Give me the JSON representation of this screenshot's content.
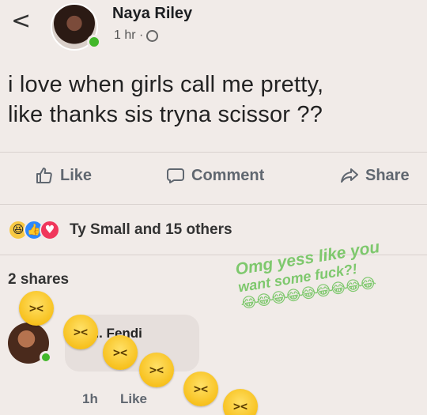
{
  "header": {
    "back_glyph": "<",
    "author": "Naya Riley",
    "time": "1 hr · "
  },
  "post": {
    "text_line1": "i love when girls call me pretty,",
    "text_line2": "like thanks sis tryna scissor ??"
  },
  "actions": {
    "like": "Like",
    "comment": "Comment",
    "share": "Share"
  },
  "reactions": {
    "summary": "Ty Small and 15 others",
    "types": [
      "haha",
      "like",
      "love"
    ]
  },
  "shares": "2 shares",
  "overlay_caption": {
    "line1": "Omg yess like you",
    "line2": "want some fuck?!",
    "emojis": "😂😂😂😂😂😂😂😂😂"
  },
  "comment": {
    "author": "d.. Fendi",
    "time": "1h",
    "like": "Like"
  },
  "colors": {
    "background": "#f1ebe8",
    "online": "#42b72a",
    "overlay_green": "#7ec86d"
  }
}
